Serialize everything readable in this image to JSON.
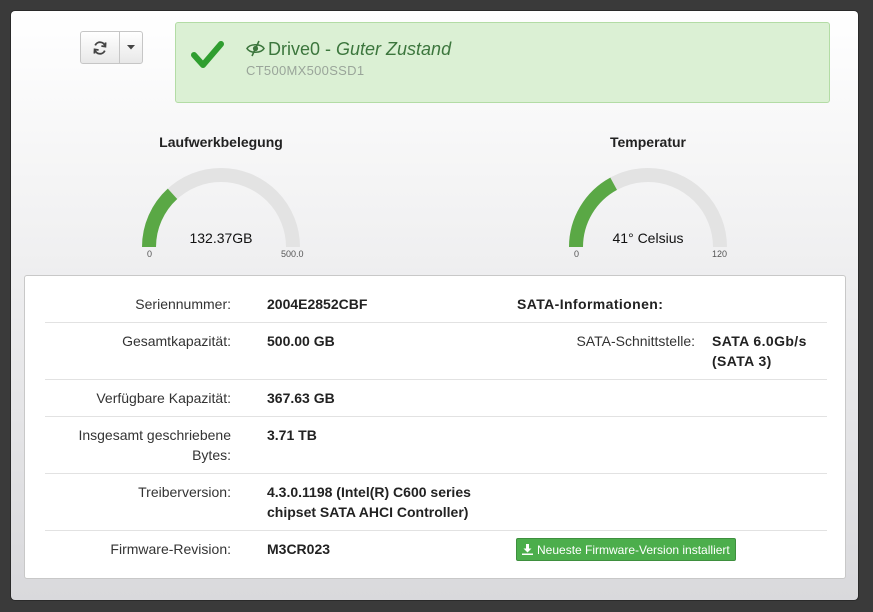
{
  "toolbar": {
    "refresh_icon": "refresh-icon",
    "caret_icon": "chevron-down-icon"
  },
  "status": {
    "drive": "Drive0",
    "separator": " - ",
    "state": "Guter Zustand",
    "model": "CT500MX500SSD1",
    "color": "#3c763d"
  },
  "gauges": {
    "usage": {
      "title": "Laufwerkbelegung",
      "value_text": "132.37GB",
      "min": "0",
      "max": "500.0",
      "value": 132.37,
      "max_value": 500
    },
    "temp": {
      "title": "Temperatur",
      "value_text": "41° Celsius",
      "min": "0",
      "max": "120",
      "value": 41,
      "max_value": 120
    },
    "fill_color": "#5aa845",
    "track_color": "#e3e3e3"
  },
  "details": {
    "serial_label": "Seriennummer:",
    "serial_value": "2004E2852CBF",
    "capacity_label": "Gesamtkapazität:",
    "capacity_value": "500.00 GB",
    "available_label": "Verfügbare Kapazität:",
    "available_value": "367.63 GB",
    "written_label_1": "Insgesamt geschriebene",
    "written_label_2": "Bytes:",
    "written_value": "3.71 TB",
    "driver_label": "Treiberversion:",
    "driver_value_1": "4.3.0.1198 (Intel(R) C600 series",
    "driver_value_2": "chipset SATA AHCI Controller)",
    "firmware_label": "Firmware-Revision:",
    "firmware_value": "M3CR023",
    "sata_heading": "SATA-Informationen:",
    "sata_iface_label": "SATA-Schnittstelle:",
    "sata_iface_value_1": "SATA 6.0Gb/s",
    "sata_iface_value_2": "(SATA 3)",
    "firmware_button": "Neueste Firmware-Version installiert"
  }
}
